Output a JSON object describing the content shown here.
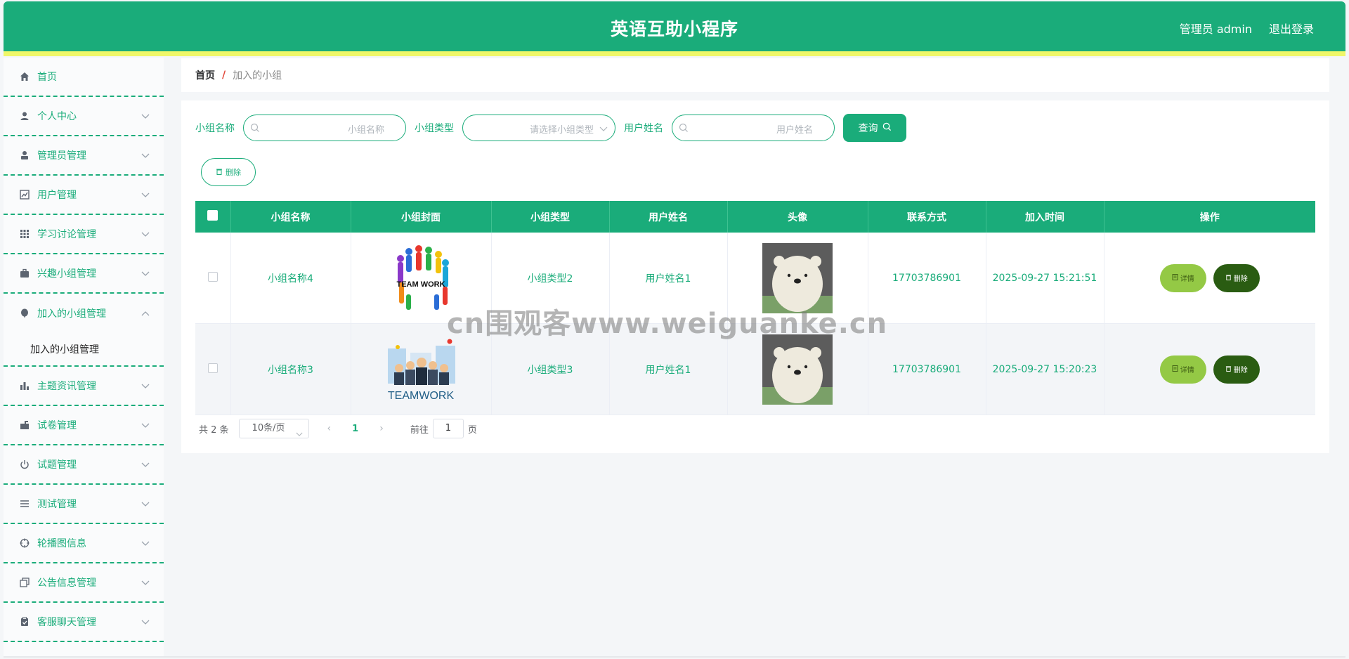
{
  "header": {
    "title": "英语互助小程序",
    "user_label": "管理员 admin",
    "logout_label": "退出登录"
  },
  "sidebar": {
    "items": [
      {
        "label": "首页",
        "icon": "home-icon"
      },
      {
        "label": "个人中心",
        "icon": "user-icon"
      },
      {
        "label": "管理员管理",
        "icon": "admin-icon"
      },
      {
        "label": "用户管理",
        "icon": "line-chart-icon"
      },
      {
        "label": "学习讨论管理",
        "icon": "grid-icon"
      },
      {
        "label": "兴趣小组管理",
        "icon": "briefcase-icon"
      },
      {
        "label": "加入的小组管理",
        "icon": "balloon-icon"
      },
      {
        "label": "主题资讯管理",
        "icon": "bar-chart-icon"
      },
      {
        "label": "试卷管理",
        "icon": "mailbox-icon"
      },
      {
        "label": "试题管理",
        "icon": "power-icon"
      },
      {
        "label": "测试管理",
        "icon": "list-icon"
      },
      {
        "label": "轮播图信息",
        "icon": "aim-icon"
      },
      {
        "label": "公告信息管理",
        "icon": "copy-icon"
      },
      {
        "label": "客服聊天管理",
        "icon": "clipboard-icon"
      }
    ],
    "submenu_label": "加入的小组管理"
  },
  "breadcrumb": {
    "home": "首页",
    "separator": "/",
    "current": "加入的小组"
  },
  "filters": {
    "group_name_label": "小组名称",
    "group_name_placeholder": "小组名称",
    "group_type_label": "小组类型",
    "group_type_placeholder": "请选择小组类型",
    "user_name_label": "用户姓名",
    "user_name_placeholder": "用户姓名",
    "query_label": "查询",
    "batch_delete_label": "删除"
  },
  "table": {
    "headers": [
      "小组名称",
      "小组封面",
      "小组类型",
      "用户姓名",
      "头像",
      "联系方式",
      "加入时间",
      "操作"
    ],
    "rows": [
      {
        "group_name": "小组名称4",
        "group_type": "小组类型2",
        "user_name": "用户姓名1",
        "phone": "17703786901",
        "join_time": "2025-09-27 15:21:51",
        "cover_text": "TEAM WORK"
      },
      {
        "group_name": "小组名称3",
        "group_type": "小组类型3",
        "user_name": "用户姓名1",
        "phone": "17703786901",
        "join_time": "2025-09-27 15:20:23",
        "cover_text": "TEAMWORK"
      }
    ],
    "detail_label": "详情",
    "delete_label": "删除"
  },
  "pagination": {
    "total": "共 2 条",
    "page_size": "10条/页",
    "current_page": "1",
    "goto_prefix": "前往",
    "goto_value": "1",
    "goto_suffix": "页"
  },
  "watermark": "cn围观客www.weiguanke.cn",
  "colors": {
    "primary": "#1aac7a",
    "stripe": "#eff769",
    "detail_button": "#94c945",
    "delete_button": "#2a5c12"
  }
}
